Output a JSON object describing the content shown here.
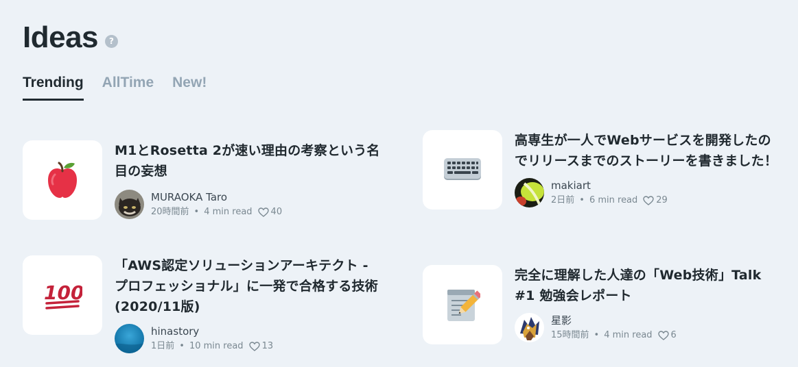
{
  "header": {
    "title": "Ideas",
    "help_glyph": "?"
  },
  "tabs": [
    {
      "label": "Trending",
      "active": true
    },
    {
      "label": "AllTime",
      "active": false
    },
    {
      "label": "New!",
      "active": false
    }
  ],
  "articles": [
    {
      "emoji": "🍎",
      "icon": "red-apple-icon",
      "title": "M1とRosetta 2が速い理由の考察という名目の妄想",
      "author": "MURAOKA Taro",
      "time": "20時間前",
      "read": "4 min read",
      "likes": "40"
    },
    {
      "emoji": "⌨️",
      "icon": "keyboard-icon",
      "title": "高専生が一人でWebサービスを開発したのでリリースまでのストーリーを書きました！",
      "author": "makiart",
      "time": "2日前",
      "read": "6 min read",
      "likes": "29"
    },
    {
      "emoji": "💯",
      "icon": "hundred-points-icon",
      "title": "「AWS認定ソリューションアーキテクト - プロフェッショナル」に一発で合格する技術(2020/11版)",
      "author": "hinastory",
      "time": "1日前",
      "read": "10 min read",
      "likes": "13"
    },
    {
      "emoji": "📝",
      "icon": "memo-icon",
      "title": "完全に理解した人達の「Web技術」Talk #1 勉強会レポート",
      "author": "星影",
      "time": "15時間前",
      "read": "4 min read",
      "likes": "6"
    }
  ],
  "separator": "•",
  "colors": {
    "background": "#edf2f7",
    "card": "#ffffff",
    "text": "#20292f",
    "muted": "#7a8891",
    "tab_inactive": "#93a5b4"
  }
}
